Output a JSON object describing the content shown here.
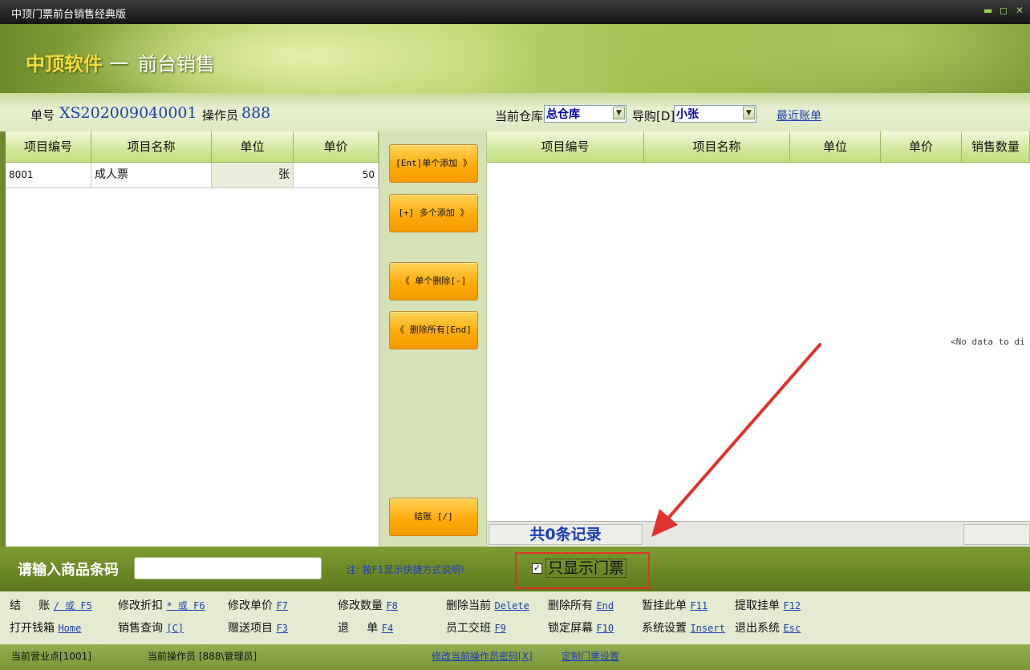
{
  "window": {
    "title": "中顶门票前台销售经典版",
    "buttons": [
      "▬",
      "◻",
      "✕"
    ]
  },
  "banner": {
    "logo": "中顶软件",
    "separator": "一",
    "title": "前台销售"
  },
  "info": {
    "order_label": "单号",
    "order_no": "XS202009040001",
    "operator_label": "操作员",
    "operator_value": "888",
    "warehouse_label": "当前仓库",
    "warehouse_value": "总仓库",
    "guide_label": "导购[D]",
    "guide_value": "小张",
    "recent_bills": "最近账单"
  },
  "left_grid": {
    "headers": [
      "项目编号",
      "项目名称",
      "单位",
      "单价"
    ],
    "rows": [
      [
        "8001",
        "成人票",
        "张",
        "50"
      ]
    ]
  },
  "middle_buttons": {
    "add_single": "[Ent]单个添加 》",
    "add_multi": "[+] 多个添加 》",
    "del_single": "《  单个删除[-]",
    "del_all": "《  删除所有[End]",
    "checkout": "结账 [/]"
  },
  "right_grid": {
    "headers": [
      "项目编号",
      "项目名称",
      "单位",
      "单价",
      "销售数量"
    ],
    "empty_text": "<No data to di",
    "footer_count": "共0条记录"
  },
  "barcode": {
    "label": "请输入商品条码",
    "value": "",
    "hint": "注: 按F1显示快捷方式说明!",
    "only_tickets_label": "只显示门票",
    "only_tickets_checked": true
  },
  "shortcuts": {
    "row1": [
      {
        "label": "结     账",
        "key": "/ 或 F5"
      },
      {
        "label": "修改折扣",
        "key": "* 或 F6"
      },
      {
        "label": "修改单价",
        "key": "F7"
      },
      {
        "label": "修改数量",
        "key": "F8"
      },
      {
        "label": "删除当前",
        "key": "Delete"
      },
      {
        "label": "删除所有",
        "key": "End"
      },
      {
        "label": "暂挂此单",
        "key": "F11"
      },
      {
        "label": "提取挂单",
        "key": "F12"
      }
    ],
    "row2": [
      {
        "label": "打开钱箱",
        "key": "Home"
      },
      {
        "label": "销售查询",
        "key": "[C]"
      },
      {
        "label": "赠送项目",
        "key": "F3"
      },
      {
        "label": "退     单",
        "key": "F4"
      },
      {
        "label": "员工交班",
        "key": "F9"
      },
      {
        "label": "锁定屏幕",
        "key": "F10"
      },
      {
        "label": "系统设置",
        "key": "Insert"
      },
      {
        "label": "退出系统",
        "key": "Esc"
      }
    ]
  },
  "status": {
    "business_point": "当前营业点[1001]",
    "current_operator": "当前操作员 [888\\管理员]",
    "change_password": "修改当前操作员密码[X]",
    "ticket_settings": "定制门票设置"
  },
  "colors": {
    "accent_blue": "#1a3fb5",
    "button_orange": "#ffac0a",
    "annotation_red": "#e0332b",
    "header_green": "#c3dd7e"
  }
}
